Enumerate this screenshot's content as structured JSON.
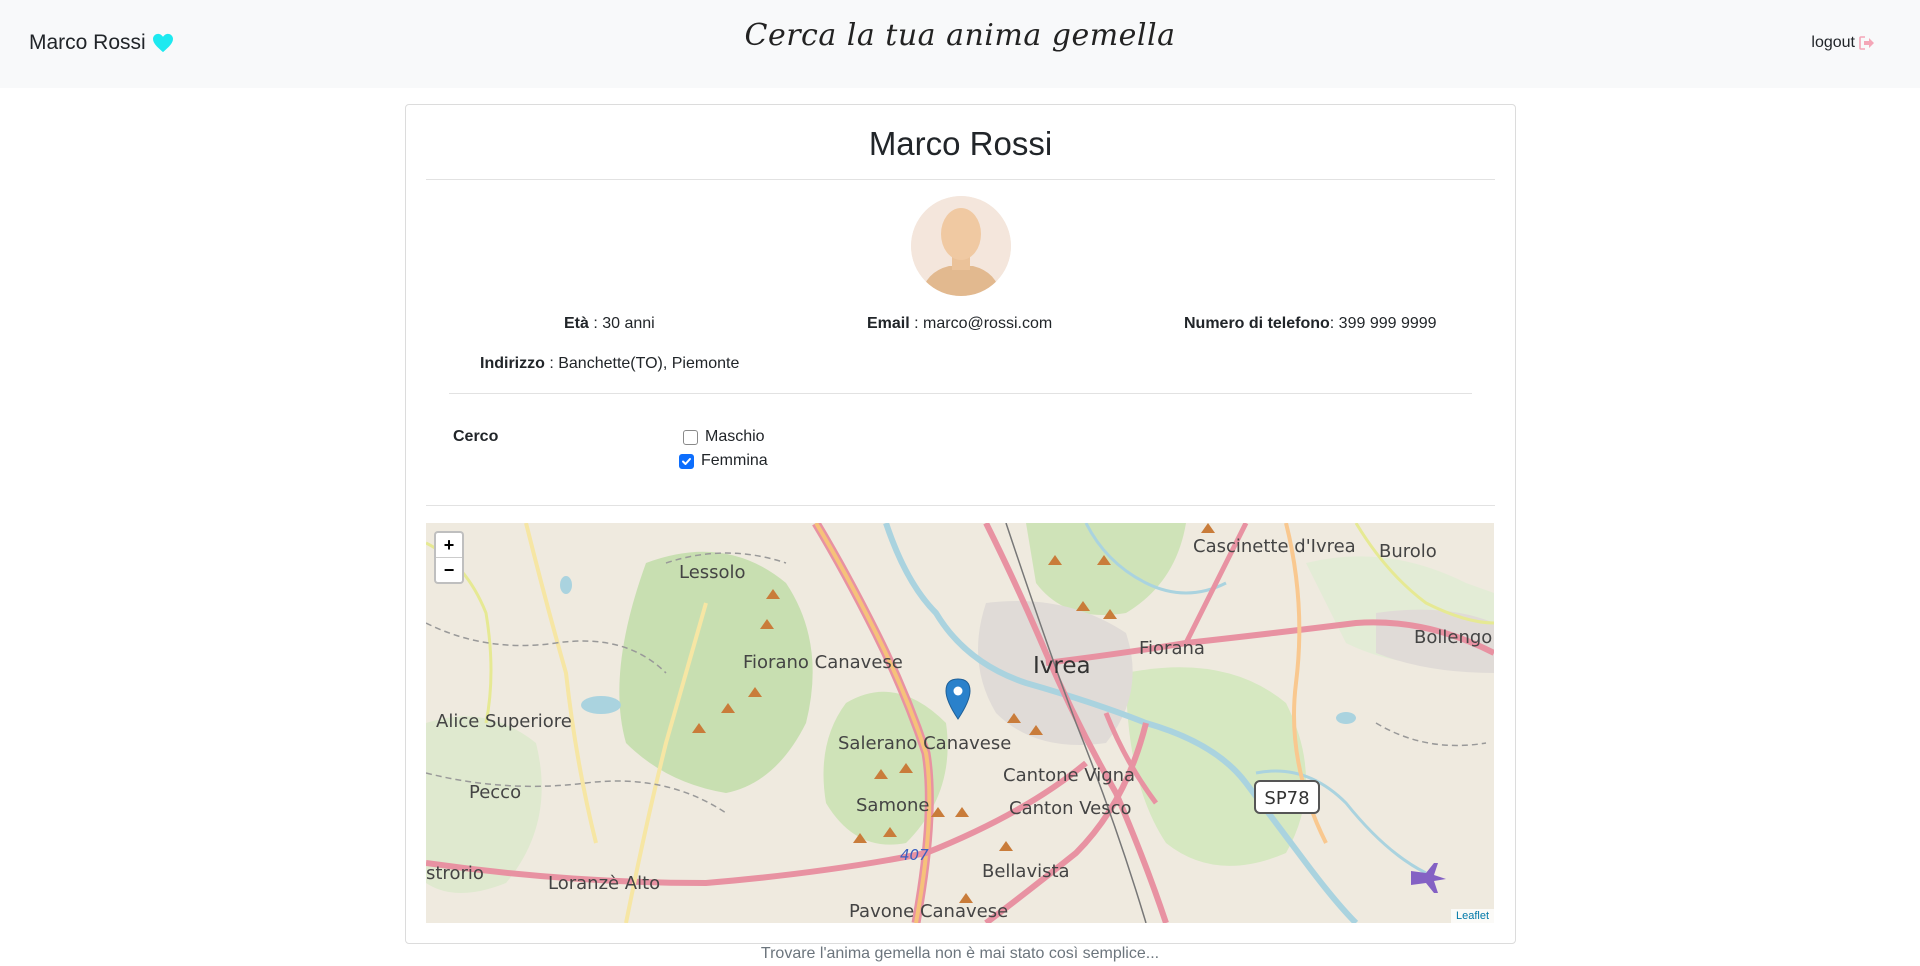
{
  "navbar": {
    "user_name": "Marco Rossi",
    "site_title": "Cerca la tua anima gemella",
    "logout_label": "logout"
  },
  "profile": {
    "name": "Marco Rossi",
    "age_label": "Età",
    "age_value": " : 30 anni",
    "email_label": "Email",
    "email_value": " : marco@rossi.com",
    "phone_label": "Numero di telefono",
    "phone_value": ": 399 999 9999",
    "address_label": "Indirizzo",
    "address_value": " : Banchette(TO), Piemonte"
  },
  "search": {
    "label": "Cerco",
    "options": [
      {
        "label": "Maschio",
        "checked": false
      },
      {
        "label": "Femmina",
        "checked": true
      }
    ]
  },
  "map": {
    "zoom_in": "+",
    "zoom_out": "−",
    "attribution": "Leaflet",
    "places": [
      "Lessolo",
      "Cascinette d'Ivrea",
      "Burolo",
      "Fiorano Canavese",
      "Ivrea",
      "Fiorana",
      "Bollengo",
      "Alice Superiore",
      "Salerano Canavese",
      "Cantone Vigna",
      "Canton Vesco",
      "Pecco",
      "Samone",
      "SP78",
      "407",
      "strorio",
      "Loranzè Alto",
      "Bellavista",
      "Pavone Canavese"
    ]
  },
  "footer": {
    "text": "Trovare l'anima gemella non è mai stato così semplice..."
  },
  "colors": {
    "heart": "#1de9f0",
    "logout_icon": "#f4a6b7",
    "checkbox": "#0d6efd",
    "marker": "#2a81cb"
  }
}
